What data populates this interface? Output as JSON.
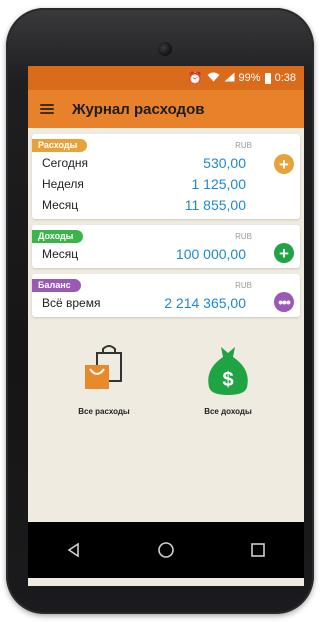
{
  "status": {
    "battery": "99%",
    "time": "0:38"
  },
  "app": {
    "title": "Журнал расходов"
  },
  "expenses": {
    "badge": "Расходы",
    "currency": "RUB",
    "badge_color": "#e8a23a",
    "rows": [
      {
        "label": "Сегодня",
        "value": "530,00"
      },
      {
        "label": "Неделя",
        "value": "1 125,00"
      },
      {
        "label": "Месяц",
        "value": "11 855,00"
      }
    ]
  },
  "income": {
    "badge": "Доходы",
    "currency": "RUB",
    "badge_color": "#3bb54a",
    "rows": [
      {
        "label": "Месяц",
        "value": "100 000,00"
      }
    ]
  },
  "balance": {
    "badge": "Баланс",
    "currency": "RUB",
    "badge_color": "#9b59b6",
    "rows": [
      {
        "label": "Всё время",
        "value": "2 214 365,00"
      }
    ]
  },
  "tiles": {
    "all_expenses": "Все расходы",
    "all_income": "Все доходы"
  },
  "icons": {
    "menu": "hamburger-icon",
    "add_expense": "plus-circle-icon",
    "add_income": "plus-circle-icon",
    "balance_more": "more-dots-icon",
    "expenses_tile": "shopping-bag-icon",
    "income_tile": "money-bag-icon",
    "nav_back": "back-triangle-icon",
    "nav_home": "home-circle-icon",
    "nav_recent": "recent-square-icon"
  },
  "colors": {
    "accent": "#e8822a",
    "statusbar": "#d96b1b",
    "value": "#1e88d0",
    "background": "#efebe0"
  }
}
